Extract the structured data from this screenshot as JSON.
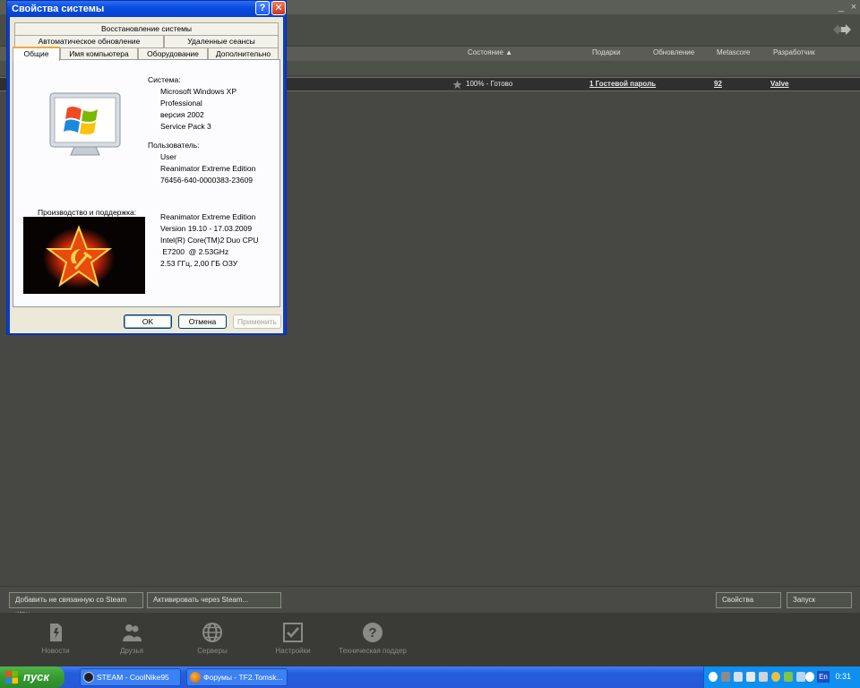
{
  "steam": {
    "window_controls": {
      "minimize": "_",
      "close": "×"
    },
    "columns": {
      "status": "Состояние ▲",
      "gifts": "Подарки",
      "update": "Обновление",
      "metascore": "Metascore",
      "developer": "Разработчик"
    },
    "game_row": {
      "status": "100% - Готово",
      "gifts": "1 Гостевой пароль",
      "metascore": "92",
      "developer": "Valve"
    },
    "buttons": {
      "add_game": "Добавить не связанную со Steam игру...",
      "activate": "Активировать через Steam...",
      "properties": "Свойства",
      "launch": "Запуск"
    },
    "nav": [
      {
        "label": "Новости"
      },
      {
        "label": "Друзья"
      },
      {
        "label": "Серверы"
      },
      {
        "label": "Настройки"
      },
      {
        "label": "Техническая поддер"
      }
    ]
  },
  "dialog": {
    "title": "Свойства системы",
    "help_glyph": "?",
    "close_glyph": "✕",
    "tabs_row1": [
      "Восстановление системы"
    ],
    "tabs_row2": [
      "Автоматическое обновление",
      "Удаленные сеансы"
    ],
    "tabs_row3": [
      "Общие",
      "Имя компьютера",
      "Оборудование",
      "Дополнительно"
    ],
    "system_label": "Система:",
    "system_lines": [
      "Microsoft Windows XP",
      "Professional",
      "версия 2002",
      "Service Pack 3"
    ],
    "user_label": "Пользователь:",
    "user_lines": [
      "User",
      "Reanimator Extreme Edition",
      "76456-640-0000383-23609"
    ],
    "support_label": "Производство и поддержка:",
    "support_lines": [
      "Reanimator Extreme Edition",
      "Version 19.10 - 17.03.2009",
      "Intel(R) Core(TM)2 Duo CPU",
      " E7200  @ 2.53GHz",
      "2.53 ГГц, 2,00 ГБ ОЗУ"
    ],
    "buttons": {
      "ok": "OK",
      "cancel": "Отмена",
      "apply": "Применить"
    }
  },
  "taskbar": {
    "start": "пуск",
    "tasks": [
      "STEAM - CoolNike95",
      "Форумы - TF2.Tomsk..."
    ],
    "lang": "En",
    "clock": "0:31"
  }
}
